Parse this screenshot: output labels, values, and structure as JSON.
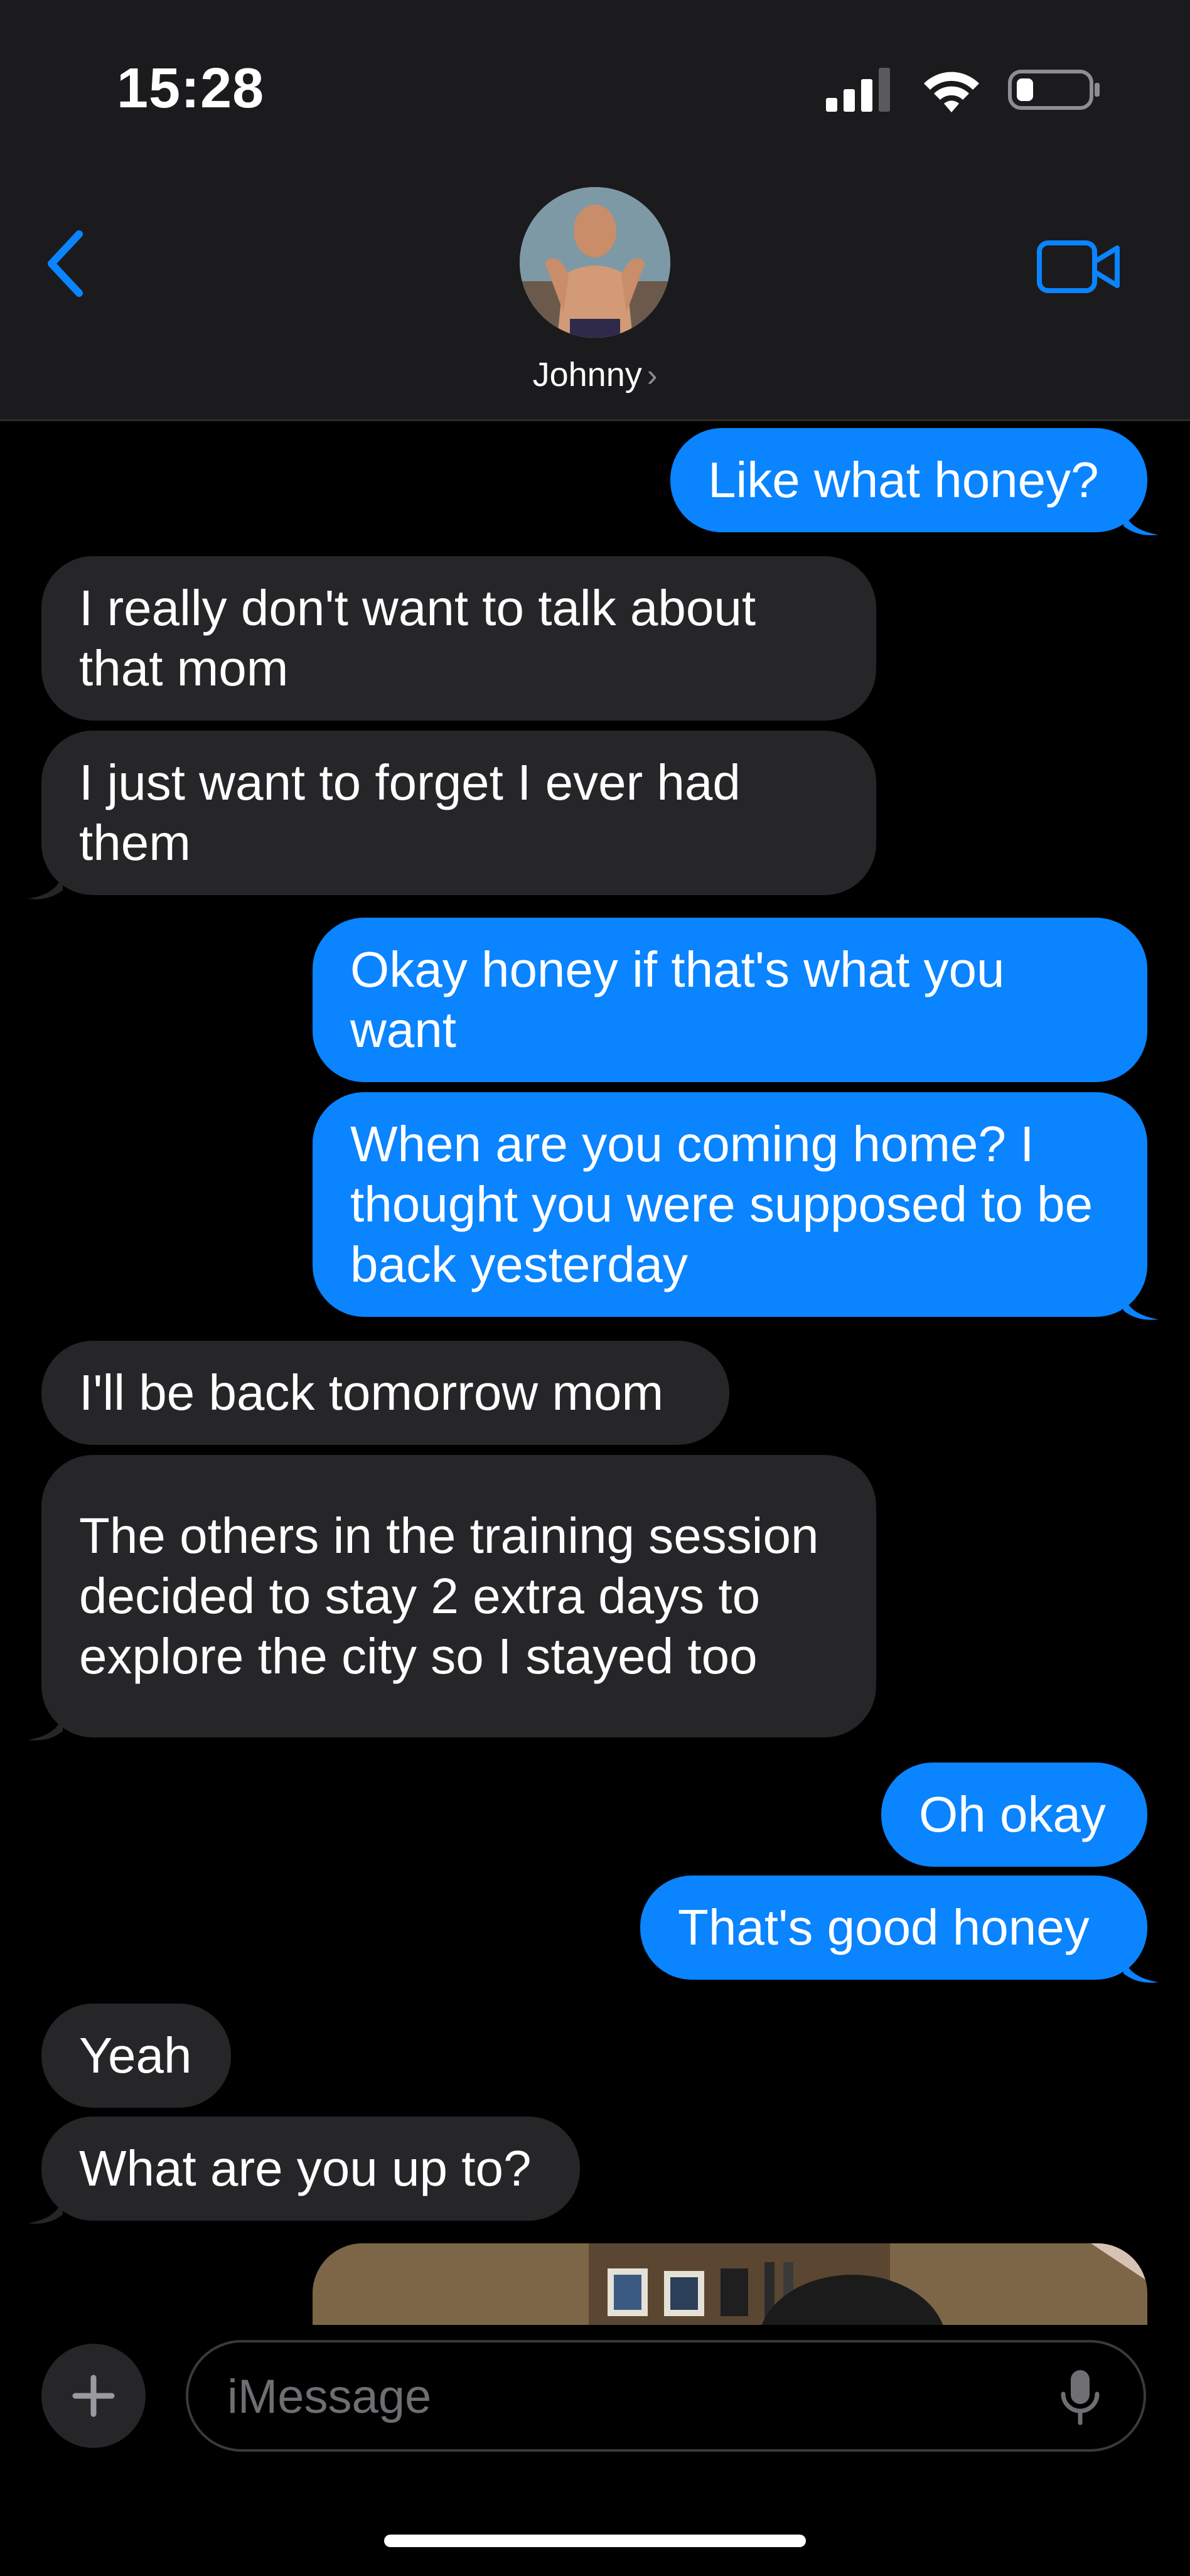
{
  "status_bar": {
    "time": "15:28"
  },
  "header": {
    "contact_name": "Johnny",
    "back_icon": "chevron-left-icon",
    "video_icon": "video-camera-icon"
  },
  "colors": {
    "outgoing_bubble": "#0a84ff",
    "incoming_bubble": "#262629",
    "accent": "#0a84ff"
  },
  "messages": [
    {
      "direction": "outgoing",
      "text": "Like what honey?"
    },
    {
      "direction": "incoming",
      "text": "I really don't want to talk about that mom"
    },
    {
      "direction": "incoming",
      "text": "I just want to forget I ever had them"
    },
    {
      "direction": "outgoing",
      "text": "Okay honey if that's what you want"
    },
    {
      "direction": "outgoing",
      "text": "When are you coming home? I thought you were supposed to be back yesterday"
    },
    {
      "direction": "incoming",
      "text": "I'll be back tomorrow mom"
    },
    {
      "direction": "incoming",
      "text": "The others in the training session decided to stay 2 extra days to explore the city so I stayed too"
    },
    {
      "direction": "outgoing",
      "text": "Oh okay"
    },
    {
      "direction": "outgoing",
      "text": "That's good honey"
    },
    {
      "direction": "incoming",
      "text": "Yeah"
    },
    {
      "direction": "incoming",
      "text": "What are you up to?"
    }
  ],
  "composer": {
    "placeholder": "iMessage",
    "plus_icon": "plus-icon",
    "mic_icon": "microphone-icon"
  }
}
